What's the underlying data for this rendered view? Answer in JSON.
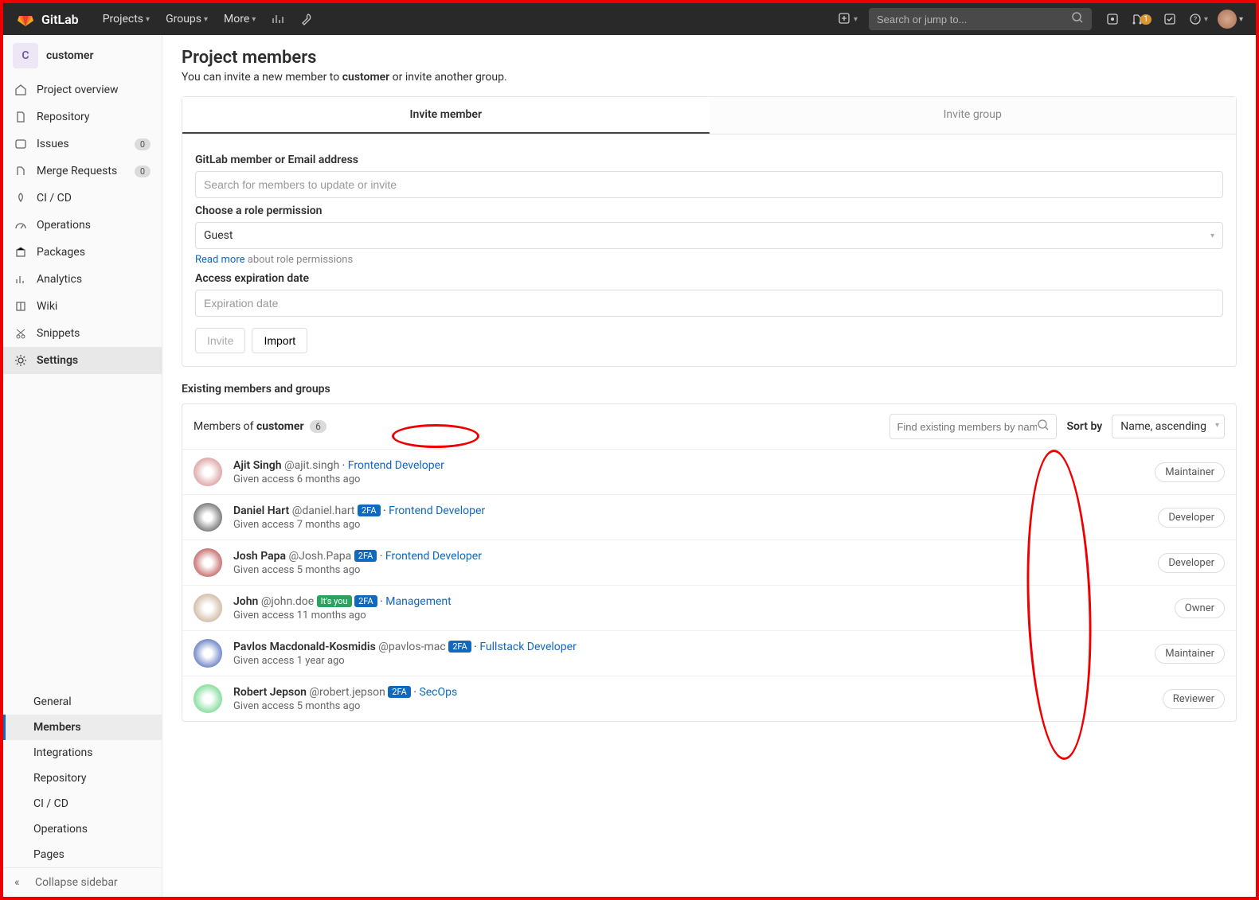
{
  "topbar": {
    "brand": "GitLab",
    "nav": {
      "projects": "Projects",
      "groups": "Groups",
      "more": "More"
    },
    "search_placeholder": "Search or jump to...",
    "mr_count": "1"
  },
  "sidebar": {
    "project_initial": "C",
    "project_name": "customer",
    "items": [
      {
        "label": "Project overview"
      },
      {
        "label": "Repository"
      },
      {
        "label": "Issues",
        "count": "0"
      },
      {
        "label": "Merge Requests",
        "count": "0"
      },
      {
        "label": "CI / CD"
      },
      {
        "label": "Operations"
      },
      {
        "label": "Packages"
      },
      {
        "label": "Analytics"
      },
      {
        "label": "Wiki"
      },
      {
        "label": "Snippets"
      },
      {
        "label": "Settings"
      }
    ],
    "settings_sub": [
      "General",
      "Members",
      "Integrations",
      "Repository",
      "CI / CD",
      "Operations",
      "Pages"
    ],
    "collapse": "Collapse sidebar"
  },
  "page": {
    "title": "Project members",
    "subtitle_pre": "You can invite a new member to ",
    "subtitle_proj": "customer",
    "subtitle_post": " or invite another group."
  },
  "invite": {
    "tab_member": "Invite member",
    "tab_group": "Invite group",
    "label_member": "GitLab member or Email address",
    "placeholder_member": "Search for members to update or invite",
    "label_role": "Choose a role permission",
    "role_value": "Guest",
    "readmore_link": "Read more",
    "readmore_rest": " about role permissions",
    "label_expire": "Access expiration date",
    "placeholder_expire": "Expiration date",
    "btn_invite": "Invite",
    "btn_import": "Import"
  },
  "existing": {
    "section_title": "Existing members and groups",
    "header_pre": "Members of ",
    "header_proj": "customer",
    "count": "6",
    "find_placeholder": "Find existing members by name",
    "sort_label": "Sort by",
    "sort_value": "Name, ascending"
  },
  "members": [
    {
      "name": "Ajit Singh",
      "username": "@ajit.singh",
      "twofa": false,
      "you": false,
      "role_title": "Frontend Developer",
      "access": "Given access 6 months ago",
      "perm": "Maintainer",
      "avatar": "#c77"
    },
    {
      "name": "Daniel Hart",
      "username": "@daniel.hart",
      "twofa": true,
      "you": false,
      "role_title": "Frontend Developer",
      "access": "Given access 7 months ago",
      "perm": "Developer",
      "avatar": "#333"
    },
    {
      "name": "Josh Papa",
      "username": "@Josh.Papa",
      "twofa": true,
      "you": false,
      "role_title": "Frontend Developer",
      "access": "Given access 5 months ago",
      "perm": "Developer",
      "avatar": "#a22"
    },
    {
      "name": "John",
      "username": "@john.doe",
      "twofa": true,
      "you": true,
      "role_title": "Management",
      "access": "Given access 11 months ago",
      "perm": "Owner",
      "avatar": "#b97"
    },
    {
      "name": "Pavlos Macdonald-Kosmidis",
      "username": "@pavlos-mac",
      "twofa": true,
      "you": false,
      "role_title": "Fullstack Developer",
      "access": "Given access 1 year ago",
      "perm": "Maintainer",
      "avatar": "#24a"
    },
    {
      "name": "Robert Jepson",
      "username": "@robert.jepson",
      "twofa": true,
      "you": false,
      "role_title": "SecOps",
      "access": "Given access 5 months ago",
      "perm": "Reviewer",
      "avatar": "#4c6"
    }
  ],
  "badges": {
    "twofa": "2FA",
    "you": "It's you"
  }
}
